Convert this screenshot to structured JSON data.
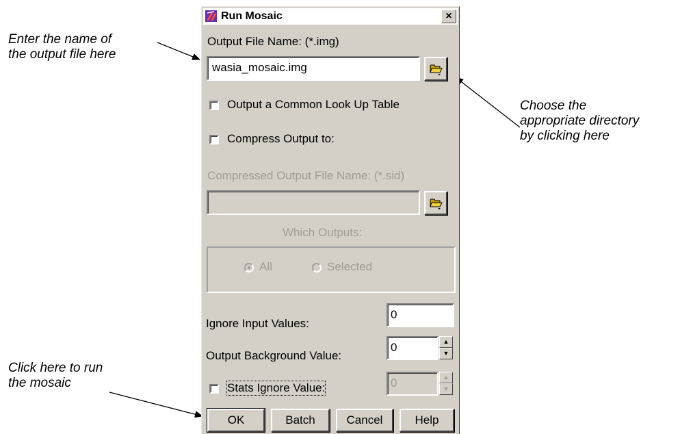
{
  "annotations": {
    "enter_name": "Enter the name of\nthe output file here",
    "choose_dir": "Choose the\nappropriate directory\nby clicking here",
    "click_run": "Click here to run\nthe mosaic"
  },
  "dialog": {
    "title": "Run Mosaic",
    "close_label": "×",
    "output_file_label": "Output File Name: (*.img)",
    "output_file_value": "wasia_mosaic.img",
    "common_lut_label": "Output a Common Look Up Table",
    "common_lut_checked": false,
    "compress_label": "Compress Output to:",
    "compress_checked": false,
    "compressed_name_label": "Compressed Output File Name: (*.sid)",
    "compressed_name_value": "",
    "which_outputs_label": "Which Outputs:",
    "radio_all": "All",
    "radio_selected": "Selected",
    "radio_selected_value": "All",
    "ignore_input_label": "Ignore Input Values:",
    "ignore_input_value": "0",
    "bg_value_label": "Output Background Value:",
    "bg_value": "0",
    "stats_ignore_label": "Stats Ignore Value:",
    "stats_ignore_checked": false,
    "stats_ignore_value": "0",
    "buttons": {
      "ok": "OK",
      "batch": "Batch",
      "cancel": "Cancel",
      "help": "Help"
    }
  },
  "colors": {
    "dialog_bg": "#d4d0c8",
    "disabled_text": "#a09c94",
    "title_icon": "#6a2fb0"
  },
  "icons": {
    "browse": "folder-open-icon",
    "app": "imagine-app-icon"
  }
}
